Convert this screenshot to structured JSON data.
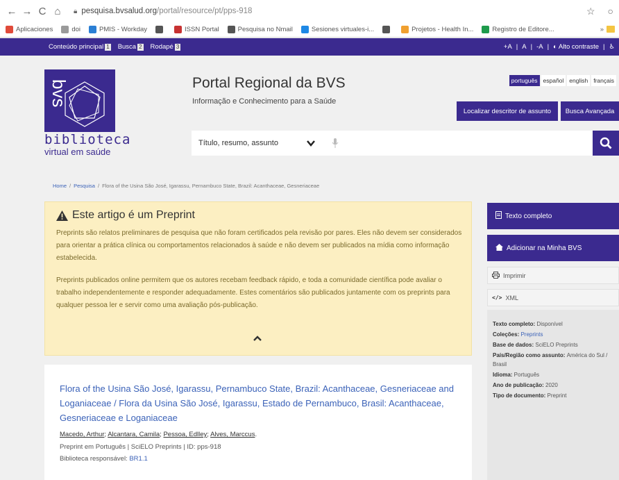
{
  "browser": {
    "url_host": "pesquisa.bvsalud.org",
    "url_path": "/portal/resource/pt/pps-918",
    "bookmarks": [
      {
        "label": "Aplicaciones",
        "color": "#e04a3a"
      },
      {
        "label": "doi",
        "color": "#9a9a9a"
      },
      {
        "label": "PMIS - Workday",
        "color": "#2a7fd4"
      },
      {
        "label": "",
        "color": "#555555"
      },
      {
        "label": "ISSN Portal",
        "color": "#c73232"
      },
      {
        "label": "Pesquisa no Nmail",
        "color": "#555555"
      },
      {
        "label": "Sesiones virtuales-i...",
        "color": "#1e88e5"
      },
      {
        "label": "",
        "color": "#555555"
      },
      {
        "label": "Projetos - Health In...",
        "color": "#f0a030"
      },
      {
        "label": "Registro de Editore...",
        "color": "#1e9b4c"
      }
    ],
    "bookmarks_more": "»"
  },
  "access_bar": {
    "links": [
      {
        "label": "Conteúdo principal",
        "key": "1"
      },
      {
        "label": "Busca",
        "key": "2"
      },
      {
        "label": "Rodapé",
        "key": "3"
      }
    ],
    "font_sizes": [
      "+A",
      "A",
      "-A"
    ],
    "contrast": "Alto contraste"
  },
  "header": {
    "logo_line1": "biblioteca",
    "logo_line2": "virtual em saúde",
    "title": "Portal Regional da BVS",
    "subtitle": "Informação e Conhecimento para a Saúde",
    "languages": [
      "português",
      "español",
      "english",
      "français"
    ],
    "active_language": "português",
    "btn_descriptor": "Localizar descritor de assunto",
    "btn_advanced": "Busca Avançada",
    "search_scope": "Título, resumo, assunto"
  },
  "breadcrumb": {
    "home": "Home",
    "search": "Pesquisa",
    "current": "Flora of the Usina São José, Igarassu, Pernambuco State, Brazil: Acanthaceae, Gesneriaceae"
  },
  "preprint": {
    "title": "Este artigo é um Preprint",
    "p1": "Preprints são relatos preliminares de pesquisa que não foram certificados pela revisão por pares. Eles não devem ser considerados para orientar a prática clínica ou comportamentos relacionados à saúde e não devem ser publicados na mídia como informação estabelecida.",
    "p2": "Preprints publicados online permitem que os autores recebam feedback rápido, e toda a comunidade científica pode avaliar o trabalho independentemente e responder adequadamente. Estes comentários são publicados juntamente com os preprints para qualquer pessoa ler e servir como uma avaliação pós-publicação."
  },
  "article": {
    "title": "Flora of the Usina São José, Igarassu, Pernambuco State, Brazil: Acanthaceae, Gesneriaceae and Loganiaceae / Flora da Usina São José, Igarassu, Estado de Pernambuco, Brasil: Acanthaceae, Gesneriaceae e Loganiaceae",
    "authors": [
      "Macedo, Arthur",
      "Alcantara, Camila",
      "Pessoa, Edlley",
      "Alves, Marccus"
    ],
    "meta": "Preprint em Português | SciELO Preprints | ID: pps-918",
    "library_label": "Biblioteca responsável:",
    "library_value": "BR1.1"
  },
  "sidebar": {
    "full_text": "Texto completo",
    "add_bvs": "Adicionar na Minha BVS",
    "print": "Imprimir",
    "xml": "XML",
    "info": [
      {
        "label": "Texto completo:",
        "value": "Disponível",
        "link": false
      },
      {
        "label": "Coleções:",
        "value": "Preprints",
        "link": true
      },
      {
        "label": "Base de dados:",
        "value": "SciELO Preprints",
        "link": false
      },
      {
        "label": "País/Região como assunto:",
        "value": "América do Sul / Brasil",
        "link": false
      },
      {
        "label": "Idioma:",
        "value": "Português",
        "link": false
      },
      {
        "label": "Ano de publicação:",
        "value": "2020",
        "link": false
      },
      {
        "label": "Tipo de documento:",
        "value": "Preprint",
        "link": false
      }
    ]
  },
  "colors": {
    "brand": "#3b2a8f",
    "link": "#3b62b8",
    "notice_bg": "#fcefc2"
  }
}
